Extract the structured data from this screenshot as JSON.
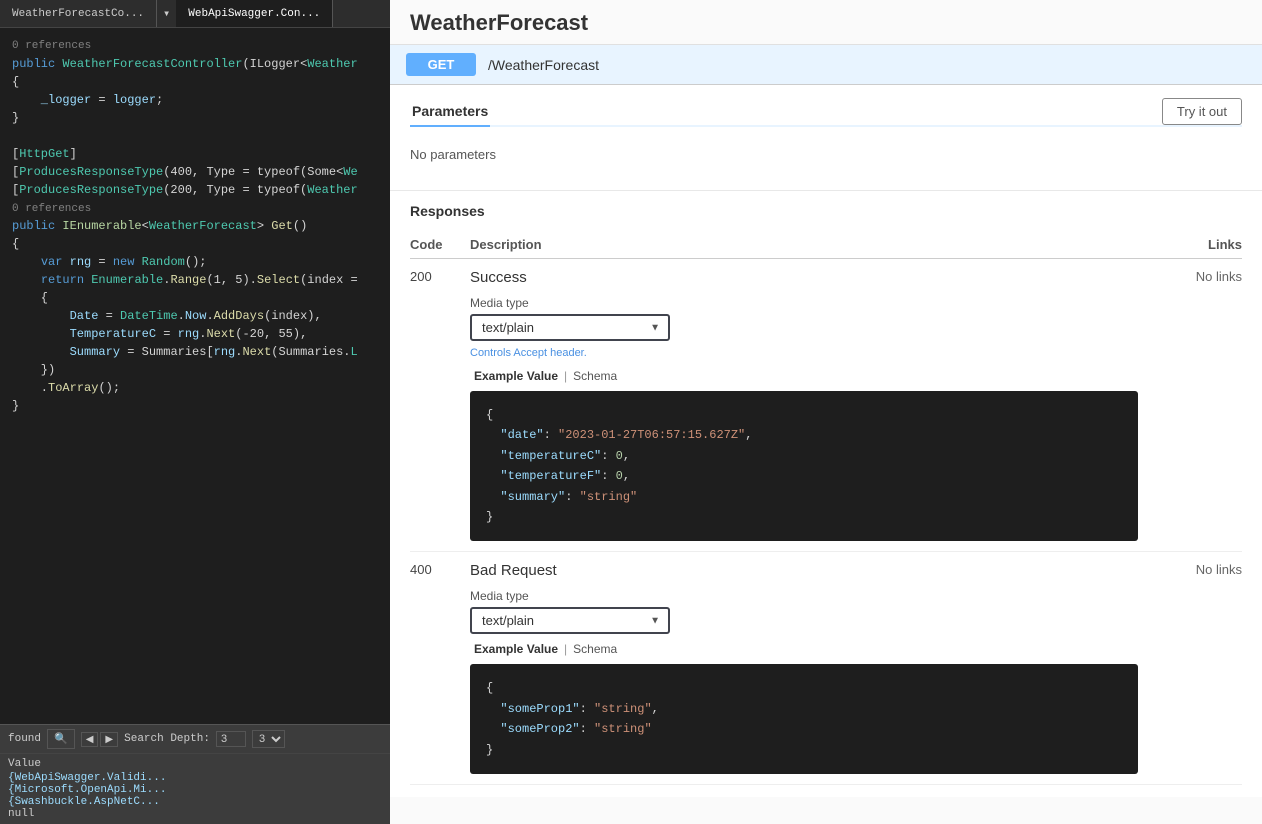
{
  "leftPanel": {
    "tabs": [
      {
        "label": "WeatherForecastCo...",
        "active": false
      },
      {
        "label": "WebApiSwagger.Con...",
        "active": true
      }
    ],
    "codeLines": [
      {
        "text": "0 references",
        "type": "ref"
      },
      {
        "text": "public WeatherForecastController(ILogger<Weather",
        "tokens": [
          {
            "text": "public ",
            "cls": "kw"
          },
          {
            "text": "WeatherForecastController",
            "cls": "type"
          },
          {
            "text": "(ILogger<",
            "cls": "punct"
          },
          {
            "text": "Weather",
            "cls": "type"
          }
        ]
      },
      {
        "text": "{",
        "type": "plain"
      },
      {
        "text": "    _logger = logger;",
        "tokens": [
          {
            "text": "    _logger",
            "cls": "attr"
          },
          {
            "text": " = ",
            "cls": "punct"
          },
          {
            "text": "logger",
            "cls": "attr"
          },
          {
            "text": ";",
            "cls": "punct"
          }
        ]
      },
      {
        "text": "}",
        "type": "plain"
      },
      {
        "text": "",
        "type": "plain"
      },
      {
        "text": "[HttpGet]",
        "tokens": [
          {
            "text": "[",
            "cls": "punct"
          },
          {
            "text": "HttpGet",
            "cls": "type"
          },
          {
            "text": "]",
            "cls": "punct"
          }
        ]
      },
      {
        "text": "[ProducesResponseType(400, Type = typeof(Some<We",
        "tokens": [
          {
            "text": "[",
            "cls": "punct"
          },
          {
            "text": "ProducesResponseType",
            "cls": "type"
          },
          {
            "text": "(400, Type = typeof(Some<",
            "cls": "punct"
          },
          {
            "text": "We",
            "cls": "type"
          }
        ]
      },
      {
        "text": "[ProducesResponseType(200, Type = typeof(Weather",
        "tokens": [
          {
            "text": "[",
            "cls": "punct"
          },
          {
            "text": "ProducesResponseType",
            "cls": "type"
          },
          {
            "text": "(200, Type = typeof(",
            "cls": "punct"
          },
          {
            "text": "Weather",
            "cls": "type"
          }
        ]
      },
      {
        "text": "0 references",
        "type": "ref"
      },
      {
        "text": "public IEnumerable<WeatherForecast> Get()",
        "tokens": [
          {
            "text": "public ",
            "cls": "kw"
          },
          {
            "text": "IEnumerable",
            "cls": "iface"
          },
          {
            "text": "<",
            "cls": "punct"
          },
          {
            "text": "WeatherForecast",
            "cls": "type"
          },
          {
            "text": "> ",
            "cls": "punct"
          },
          {
            "text": "Get",
            "cls": "method"
          },
          {
            "text": "()",
            "cls": "punct"
          }
        ]
      },
      {
        "text": "{",
        "type": "plain"
      },
      {
        "text": "    var rng = new Random();",
        "tokens": [
          {
            "text": "    ",
            "cls": "punct"
          },
          {
            "text": "var ",
            "cls": "kw"
          },
          {
            "text": "rng",
            "cls": "attr"
          },
          {
            "text": " = ",
            "cls": "punct"
          },
          {
            "text": "new ",
            "cls": "kw"
          },
          {
            "text": "Random",
            "cls": "type"
          },
          {
            "text": "();",
            "cls": "punct"
          }
        ]
      },
      {
        "text": "    return Enumerable.Range(1, 5).Select(index =",
        "tokens": [
          {
            "text": "    ",
            "cls": "punct"
          },
          {
            "text": "return ",
            "cls": "kw"
          },
          {
            "text": "Enumerable",
            "cls": "type"
          },
          {
            "text": ".",
            "cls": "punct"
          },
          {
            "text": "Range",
            "cls": "method"
          },
          {
            "text": "(1, 5).",
            "cls": "punct"
          },
          {
            "text": "Select",
            "cls": "method"
          },
          {
            "text": "(index =",
            "cls": "punct"
          }
        ]
      },
      {
        "text": "    {",
        "type": "plain"
      },
      {
        "text": "        Date = DateTime.Now.AddDays(index),",
        "tokens": [
          {
            "text": "        Date",
            "cls": "attr"
          },
          {
            "text": " = ",
            "cls": "punct"
          },
          {
            "text": "DateTime",
            "cls": "type"
          },
          {
            "text": ".",
            "cls": "punct"
          },
          {
            "text": "Now",
            "cls": "attr"
          },
          {
            "text": ".",
            "cls": "punct"
          },
          {
            "text": "AddDays",
            "cls": "method"
          },
          {
            "text": "(index),",
            "cls": "punct"
          }
        ]
      },
      {
        "text": "        TemperatureC = rng.Next(-20, 55),",
        "tokens": [
          {
            "text": "        TemperatureC",
            "cls": "attr"
          },
          {
            "text": " = ",
            "cls": "punct"
          },
          {
            "text": "rng",
            "cls": "attr"
          },
          {
            "text": ".",
            "cls": "punct"
          },
          {
            "text": "Next",
            "cls": "method"
          },
          {
            "text": "(-20, 55),",
            "cls": "punct"
          }
        ]
      },
      {
        "text": "        Summary = Summaries[rng.Next(Summaries.L",
        "tokens": [
          {
            "text": "        Summary",
            "cls": "attr"
          },
          {
            "text": " = Summaries[",
            "cls": "punct"
          },
          {
            "text": "rng",
            "cls": "attr"
          },
          {
            "text": ".",
            "cls": "punct"
          },
          {
            "text": "Next",
            "cls": "method"
          },
          {
            "text": "(Summaries.",
            "cls": "punct"
          },
          {
            "text": "L",
            "cls": "type"
          }
        ]
      },
      {
        "text": "    })",
        "type": "plain"
      },
      {
        "text": "    .ToArray();",
        "tokens": [
          {
            "text": "    .",
            "cls": "punct"
          },
          {
            "text": "ToArray",
            "cls": "method"
          },
          {
            "text": "();",
            "cls": "punct"
          }
        ]
      },
      {
        "text": "}",
        "type": "plain"
      }
    ],
    "bottomBar": {
      "foundLabel": "found",
      "searchPlaceholder": "🔍",
      "searchDepthLabel": "Search Depth:",
      "searchDepthValue": "3"
    },
    "valuesSection": {
      "label": "Value",
      "items": [
        "{WebApiSwagger.Validi...",
        "{Microsoft.OpenApi.Mi...",
        "{Swashbuckle.AspNetC...",
        "null"
      ]
    }
  },
  "rightPanel": {
    "title": "WeatherForecast",
    "endpoint": {
      "method": "GET",
      "path": "/WeatherForecast"
    },
    "parametersTab": {
      "label": "Parameters",
      "active": true
    },
    "tryItOutBtn": "Try it out",
    "noParams": "No parameters",
    "responsesTitle": "Responses",
    "tableHeaders": {
      "code": "Code",
      "description": "Description",
      "links": "Links"
    },
    "responses": [
      {
        "code": "200",
        "descTitle": "Success",
        "links": "No links",
        "mediaTypeLabel": "Media type",
        "mediaTypeValue": "text/plain",
        "controlsNote": "Controls Accept header.",
        "exampleTab": "Example Value",
        "schemaTab": "Schema",
        "codeBlock": [
          {
            "text": "{"
          },
          {
            "text": "  \"date\": \"2023-01-27T06:57:15.627Z\",",
            "key": "\"date\"",
            "val": "\"2023-01-27T06:57:15.627Z\"",
            "valType": "str"
          },
          {
            "text": "  \"temperatureC\": 0,",
            "key": "\"temperatureC\"",
            "val": "0",
            "valType": "num"
          },
          {
            "text": "  \"temperatureF\": 0,",
            "key": "\"temperatureF\"",
            "val": "0",
            "valType": "num"
          },
          {
            "text": "  \"summary\": \"string\"",
            "key": "\"summary\"",
            "val": "\"string\"",
            "valType": "str"
          },
          {
            "text": "}"
          }
        ]
      },
      {
        "code": "400",
        "descTitle": "Bad Request",
        "links": "No links",
        "mediaTypeLabel": "Media type",
        "mediaTypeValue": "text/plain",
        "exampleTab": "Example Value",
        "schemaTab": "Schema",
        "codeBlock": [
          {
            "text": "{"
          },
          {
            "text": "  \"someProp1\": \"string\",",
            "key": "\"someProp1\"",
            "val": "\"string\"",
            "valType": "str"
          },
          {
            "text": "  \"someProp2\": \"string\"",
            "key": "\"someProp2\"",
            "val": "\"string\"",
            "valType": "str"
          },
          {
            "text": "}"
          }
        ]
      }
    ]
  }
}
